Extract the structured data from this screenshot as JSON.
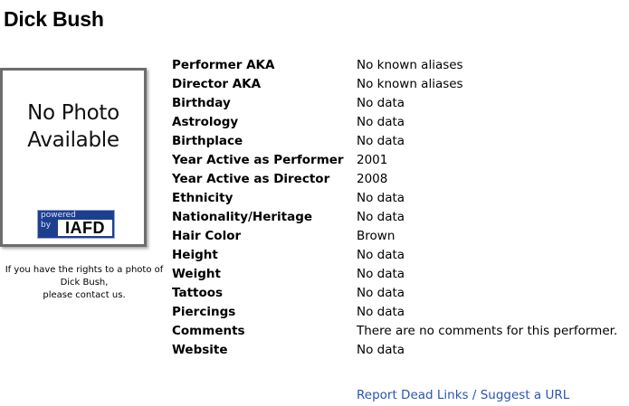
{
  "page": {
    "title": "Dick Bush"
  },
  "photo": {
    "placeholder_line1": "No Photo",
    "placeholder_line2": "Available",
    "badge_powered": "powered",
    "badge_by": "by",
    "badge_brand": "IAFD",
    "note_line1": "If you have the rights to a photo of",
    "note_line2": "Dick Bush,",
    "note_line3": "please contact us."
  },
  "bio": [
    {
      "label": "Performer AKA",
      "value": "No known aliases"
    },
    {
      "label": "Director AKA",
      "value": "No known aliases"
    },
    {
      "label": "Birthday",
      "value": "No data"
    },
    {
      "label": "Astrology",
      "value": "No data"
    },
    {
      "label": "Birthplace",
      "value": "No data"
    },
    {
      "label": "Year Active as Performer",
      "value": "2001"
    },
    {
      "label": "Year Active as Director",
      "value": "2008"
    },
    {
      "label": "Ethnicity",
      "value": "No data"
    },
    {
      "label": "Nationality/Heritage",
      "value": "No data"
    },
    {
      "label": "Hair Color",
      "value": "Brown"
    },
    {
      "label": "Height",
      "value": "No data"
    },
    {
      "label": "Weight",
      "value": "No data"
    },
    {
      "label": "Tattoos",
      "value": "No data"
    },
    {
      "label": "Piercings",
      "value": "No data"
    },
    {
      "label": "Comments",
      "value": "There are no comments for this performer."
    },
    {
      "label": "Website",
      "value": "No data"
    }
  ],
  "links": {
    "report_dead_links": "Report Dead Links",
    "separator": "/",
    "suggest_url": "Suggest a URL"
  },
  "colors": {
    "link": "#2a54b5",
    "badge_background": "#1d3f8f",
    "frame_border": "#6d6d6d"
  }
}
